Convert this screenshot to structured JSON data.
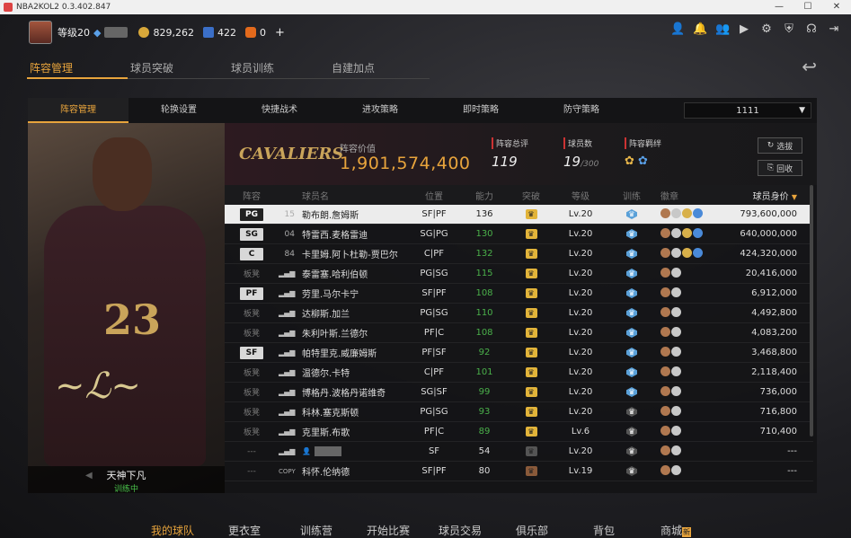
{
  "window": {
    "title": "NBA2KOL2 0.3.402.847"
  },
  "topbar": {
    "level": "等级20",
    "coins": "829,262",
    "stars": "422",
    "points": "0",
    "plus": "+"
  },
  "main_tabs": [
    "阵容管理",
    "球员突破",
    "球员训练",
    "自建加点"
  ],
  "sub_tabs": [
    "阵容管理",
    "轮换设置",
    "快捷战术",
    "进攻策略",
    "即时策略",
    "防守策略"
  ],
  "lineup_select": "1111",
  "card": {
    "name": "天神下凡",
    "status": "训练中",
    "jersey": "23"
  },
  "team": {
    "logo": "CAVALIERS",
    "value_label": "阵容价值",
    "value": "1,901,574,400",
    "rating_label": "阵容总评",
    "rating": "119",
    "count_label": "球员数",
    "count": "19",
    "count_max": "/300",
    "bond_label": "阵容羁绊",
    "btn_select": "选拔",
    "btn_recycle": "回收"
  },
  "table": {
    "headers": {
      "lineup": "阵容",
      "name": "球员名",
      "position": "位置",
      "ability": "能力",
      "breakthrough": "突破",
      "level": "等级",
      "training": "训练",
      "badges": "徽章",
      "value": "球员身价"
    },
    "rows": [
      {
        "slot": "PG",
        "num": "15",
        "name": "勒布朗.詹姆斯",
        "pos": "SF|PF",
        "ability": "136",
        "level": "Lv.20",
        "value": "793,600,000"
      },
      {
        "slot": "SG",
        "num": "04",
        "name": "特雷西.麦格雷迪",
        "pos": "SG|PG",
        "ability": "130",
        "level": "Lv.20",
        "value": "640,000,000"
      },
      {
        "slot": "C",
        "num": "84",
        "name": "卡里姆.阿卜杜勒-贾巴尔",
        "pos": "C|PF",
        "ability": "132",
        "level": "Lv.20",
        "value": "424,320,000"
      },
      {
        "slot": "板凳",
        "num": "",
        "name": "泰雷塞.哈利伯顿",
        "pos": "PG|SG",
        "ability": "115",
        "level": "Lv.20",
        "value": "20,416,000"
      },
      {
        "slot": "PF",
        "num": "",
        "name": "劳里.马尔卡宁",
        "pos": "SF|PF",
        "ability": "108",
        "level": "Lv.20",
        "value": "6,912,000"
      },
      {
        "slot": "板凳",
        "num": "",
        "name": "达柳斯.加兰",
        "pos": "PG|SG",
        "ability": "110",
        "level": "Lv.20",
        "value": "4,492,800"
      },
      {
        "slot": "板凳",
        "num": "",
        "name": "朱利叶斯.兰德尔",
        "pos": "PF|C",
        "ability": "108",
        "level": "Lv.20",
        "value": "4,083,200"
      },
      {
        "slot": "SF",
        "num": "",
        "name": "帕特里克.威廉姆斯",
        "pos": "PF|SF",
        "ability": "92",
        "level": "Lv.20",
        "value": "3,468,800"
      },
      {
        "slot": "板凳",
        "num": "",
        "name": "温德尔.卡特",
        "pos": "C|PF",
        "ability": "101",
        "level": "Lv.20",
        "value": "2,118,400"
      },
      {
        "slot": "板凳",
        "num": "",
        "name": "博格丹.波格丹诺维奇",
        "pos": "SG|SF",
        "ability": "99",
        "level": "Lv.20",
        "value": "736,000"
      },
      {
        "slot": "板凳",
        "num": "",
        "name": "科林.塞克斯顿",
        "pos": "PG|SG",
        "ability": "93",
        "level": "Lv.20",
        "value": "716,800"
      },
      {
        "slot": "板凳",
        "num": "",
        "name": "克里斯.布歌",
        "pos": "PF|C",
        "ability": "89",
        "level": "Lv.6",
        "value": "710,400"
      },
      {
        "slot": "---",
        "num": "",
        "name": "",
        "pos": "SF",
        "ability": "54",
        "level": "Lv.20",
        "value": "---"
      },
      {
        "slot": "---",
        "num": "COPY",
        "name": "科怀.伦纳德",
        "pos": "SF|PF",
        "ability": "80",
        "level": "Lv.19",
        "value": "---"
      }
    ]
  },
  "bottom_nav": [
    "我的球队",
    "更衣室",
    "训练营",
    "开始比赛",
    "球员交易",
    "俱乐部",
    "背包",
    "商城"
  ],
  "bottom_nav_badge": "新",
  "colors": {
    "accent": "#e8a43c",
    "ability_green": "#4ab04a"
  }
}
